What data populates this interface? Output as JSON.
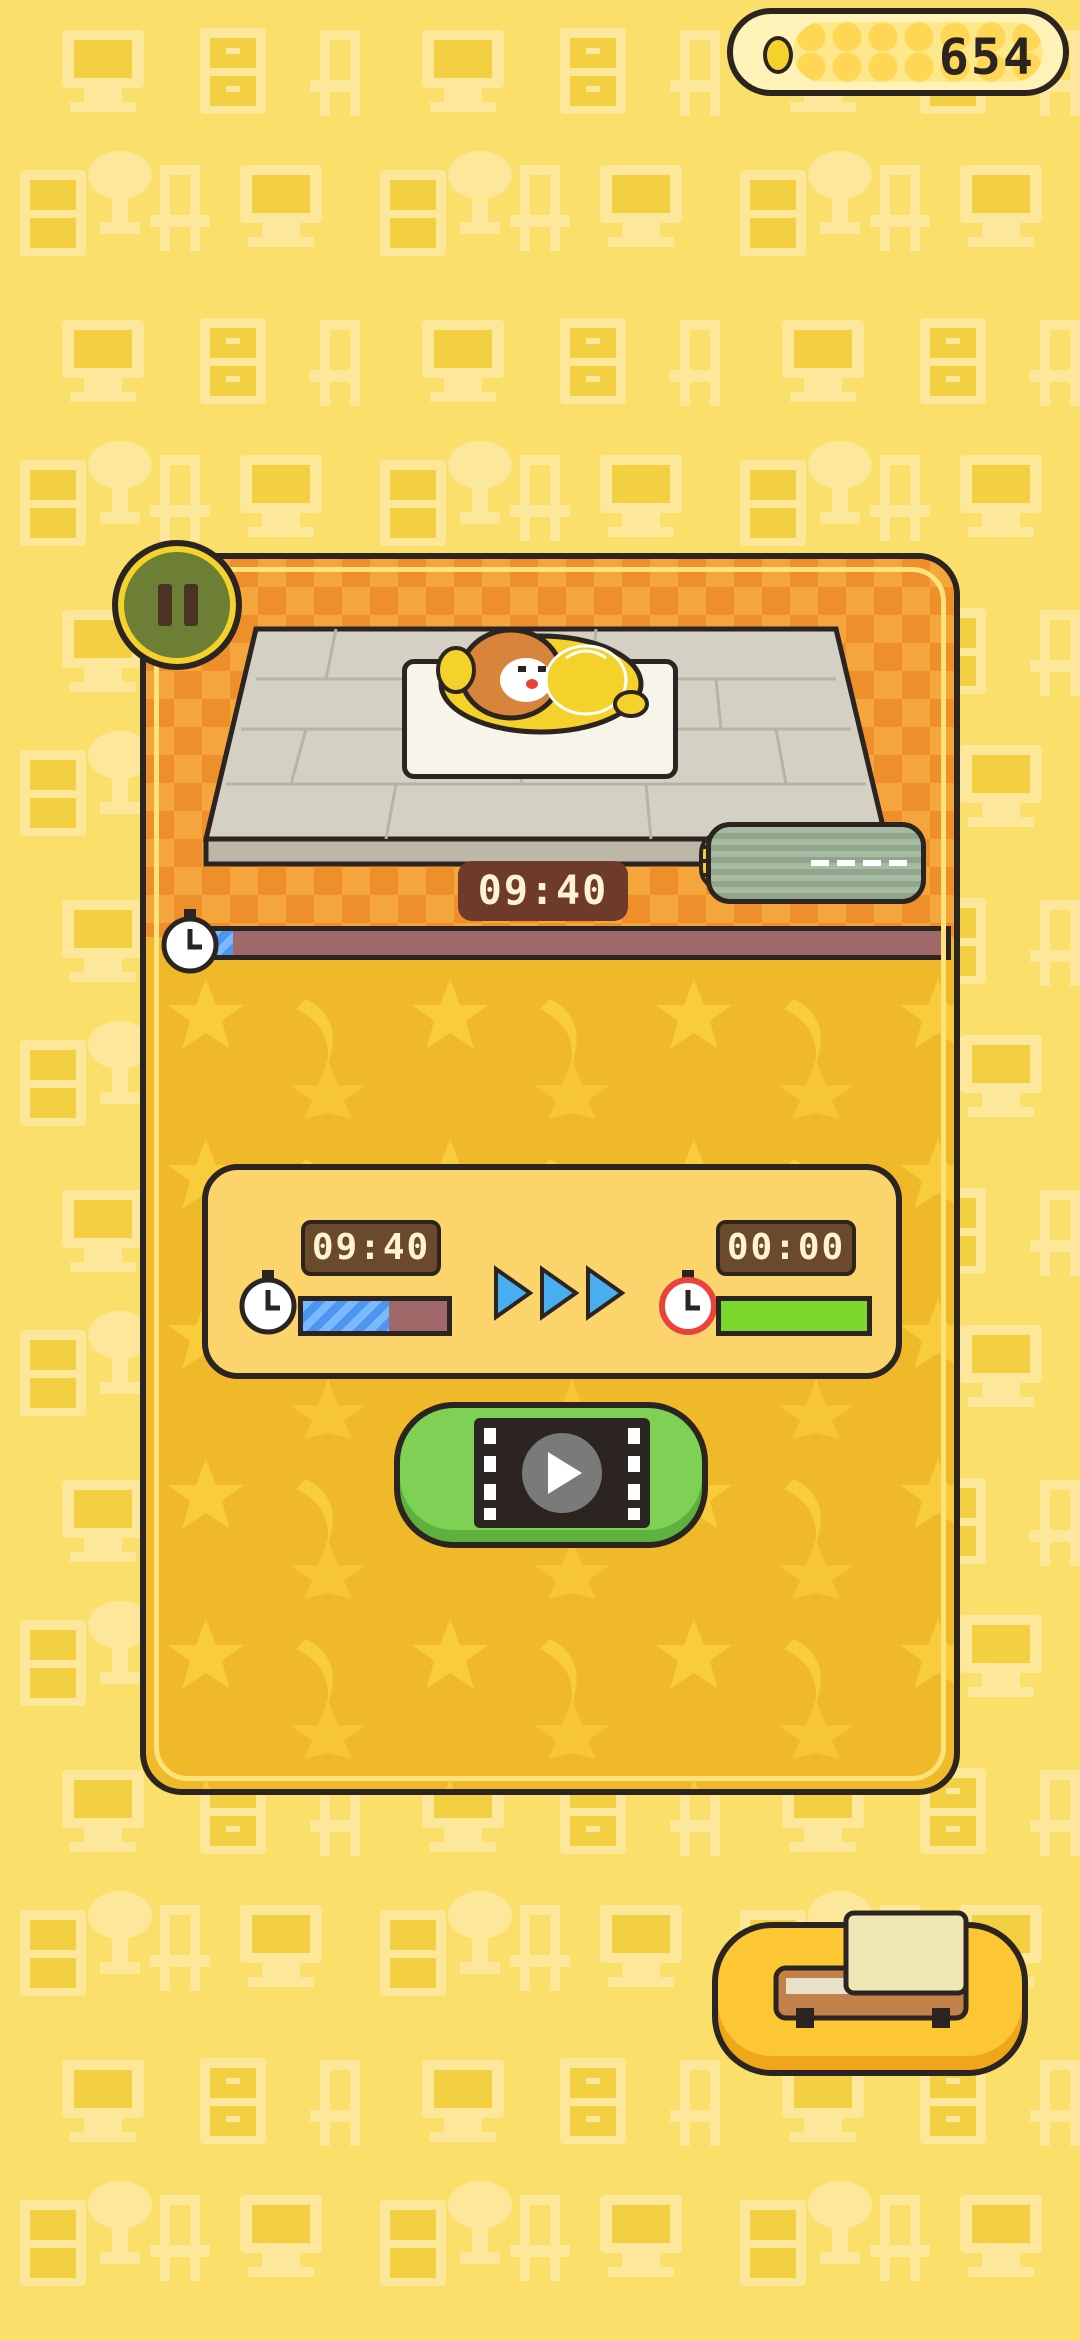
{
  "coins": {
    "value": "654",
    "icon": "coin-icon"
  },
  "scene": {
    "timer": "09:40",
    "progress": 0.03
  },
  "timer_card": {
    "current_time": "09:40",
    "current_progress": 0.6,
    "target_time": "00:00",
    "target_progress": 1.0,
    "arrows_icon": "triple-arrow-icon"
  },
  "buttons": {
    "pause_icon": "pause-icon",
    "watch_video_icon": "play-video-icon",
    "bed_icon": "bed-icon"
  },
  "colors": {
    "background": "#f3cf42",
    "panel": "#f0b92a",
    "accent_green": "#7fd156",
    "progress_blue": "#4d96f0",
    "outline": "#2b2420"
  }
}
